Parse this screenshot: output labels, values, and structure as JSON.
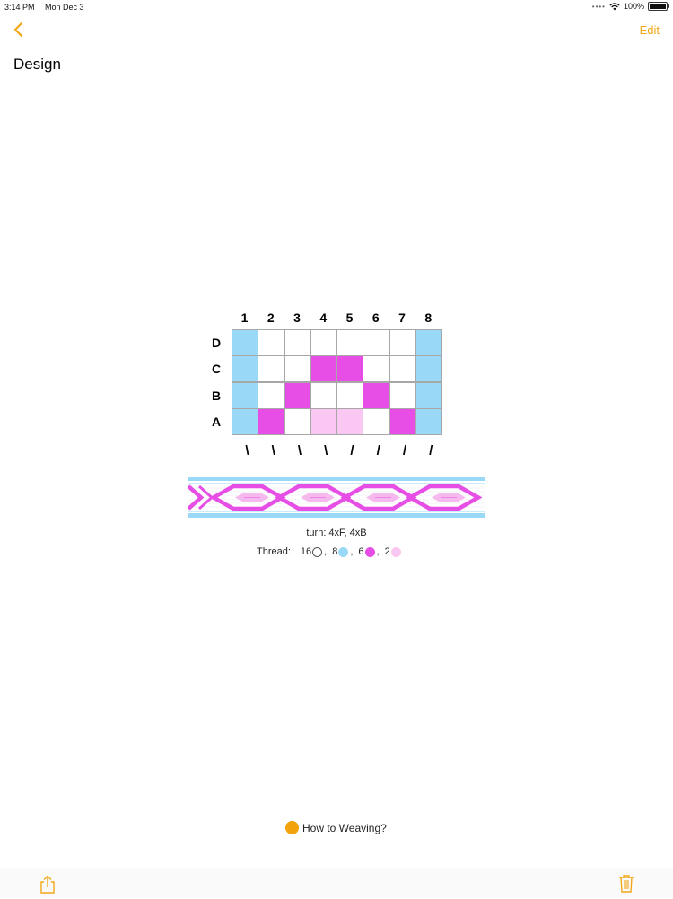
{
  "status_bar": {
    "time": "3:14 PM",
    "date": "Mon Dec 3",
    "battery": "100%"
  },
  "nav": {
    "back_icon": "chevron-left-icon",
    "edit_label": "Edit",
    "title": "Design"
  },
  "colors": {
    "accent": "#f0a818",
    "blue": "#99d8f6",
    "magenta": "#e64ee6",
    "pink": "#f9c7f1",
    "white": "#ffffff"
  },
  "columns": [
    "1",
    "2",
    "3",
    "4",
    "5",
    "6",
    "7",
    "8"
  ],
  "rows": [
    {
      "label": "D",
      "cells": [
        "blue",
        "white",
        "white",
        "white",
        "white",
        "white",
        "white",
        "blue"
      ]
    },
    {
      "label": "C",
      "cells": [
        "blue",
        "white",
        "white",
        "magenta",
        "magenta",
        "white",
        "white",
        "blue"
      ]
    },
    {
      "label": "B",
      "cells": [
        "blue",
        "white",
        "magenta",
        "white",
        "white",
        "magenta",
        "white",
        "blue"
      ]
    },
    {
      "label": "A",
      "cells": [
        "blue",
        "magenta",
        "white",
        "pink",
        "pink",
        "white",
        "magenta",
        "blue"
      ]
    }
  ],
  "twists": [
    "\\",
    "\\",
    "\\",
    "\\",
    "/",
    "/",
    "/",
    "/"
  ],
  "turn": "turn: 4xF, 4xB",
  "thread": {
    "label": "Thread:",
    "items": [
      {
        "count": "16",
        "color": "white"
      },
      {
        "count": "8",
        "color": "blue"
      },
      {
        "count": "6",
        "color": "magenta"
      },
      {
        "count": "2",
        "color": "pink"
      }
    ],
    "separator": ","
  },
  "help": {
    "label": "How to Weaving?"
  },
  "toolbar": {
    "share_icon": "share-icon",
    "trash_icon": "trash-icon"
  }
}
